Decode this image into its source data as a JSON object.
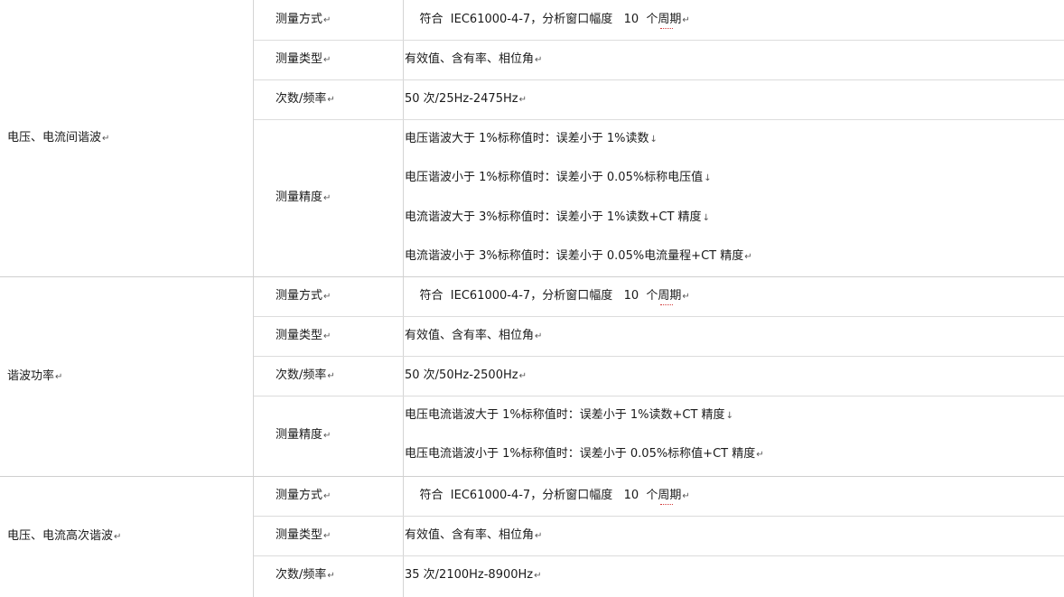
{
  "sections": [
    {
      "category": "电压、电流间谐波",
      "rows": [
        {
          "label": "测量方式",
          "lines": [
            "    符合  IEC61000-4-7，分析窗口幅度   10  个周期"
          ]
        },
        {
          "label": "测量类型",
          "lines": [
            "有效值、含有率、相位角"
          ]
        },
        {
          "label": "次数/频率",
          "lines": [
            "50 次/25Hz-2475Hz"
          ]
        },
        {
          "label": "测量精度",
          "lines": [
            "电压谐波大于 1%标称值时：误差小于 1%读数",
            "电压谐波小于 1%标称值时：误差小于 0.05%标称电压值",
            "电流谐波大于 3%标称值时：误差小于 1%读数+CT 精度",
            "电流谐波小于 3%标称值时：误差小于 0.05%电流量程+CT 精度"
          ]
        }
      ]
    },
    {
      "category": "谐波功率",
      "rows": [
        {
          "label": "测量方式",
          "lines": [
            "    符合  IEC61000-4-7，分析窗口幅度   10  个周期"
          ]
        },
        {
          "label": "测量类型",
          "lines": [
            "有效值、含有率、相位角"
          ]
        },
        {
          "label": "次数/频率",
          "lines": [
            "50 次/50Hz-2500Hz"
          ]
        },
        {
          "label": "测量精度",
          "lines": [
            "电压电流谐波大于 1%标称值时：误差小于 1%读数+CT 精度",
            "电压电流谐波小于 1%标称值时：误差小于 0.05%标称值+CT 精度"
          ]
        }
      ]
    },
    {
      "category": "电压、电流高次谐波",
      "rows": [
        {
          "label": "测量方式",
          "lines": [
            "    符合  IEC61000-4-7，分析窗口幅度   10  个周期"
          ]
        },
        {
          "label": "测量类型",
          "lines": [
            "有效值、含有率、相位角"
          ]
        },
        {
          "label": "次数/频率",
          "lines": [
            "35 次/2100Hz-8900Hz"
          ]
        }
      ]
    }
  ],
  "marks": {
    "paragraph": "↵",
    "line_break": "↓"
  },
  "colors": {
    "grid": "#d4d4d4",
    "text": "#1a1a1a",
    "spellcheck": "#d23b3b"
  }
}
